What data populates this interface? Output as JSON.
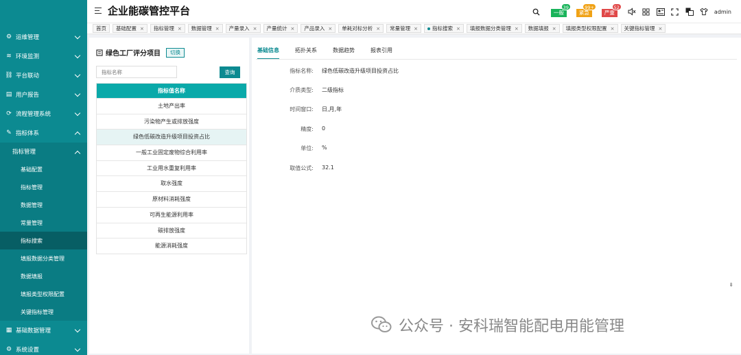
{
  "header": {
    "title": "企业能碳管控平台",
    "badges": [
      {
        "label": "一般",
        "count": "39",
        "color": "#19b35a"
      },
      {
        "label": "紧急",
        "count": "99+",
        "color": "#f0a216"
      },
      {
        "label": "严重",
        "count": "52",
        "color": "#e04848"
      }
    ],
    "user": "admin"
  },
  "tabs": [
    {
      "label": "首页",
      "closable": false
    },
    {
      "label": "基础配置",
      "closable": true
    },
    {
      "label": "指标管理",
      "closable": true
    },
    {
      "label": "数据管理",
      "closable": true
    },
    {
      "label": "产量录入",
      "closable": true
    },
    {
      "label": "产量统计",
      "closable": true
    },
    {
      "label": "产品录入",
      "closable": true
    },
    {
      "label": "单耗对标分析",
      "closable": true
    },
    {
      "label": "常量管理",
      "closable": true
    },
    {
      "label": "指标搜索",
      "closable": true,
      "active": true
    },
    {
      "label": "填报数据分类管理",
      "closable": true
    },
    {
      "label": "数据填报",
      "closable": true
    },
    {
      "label": "填报类型权限配置",
      "closable": true
    },
    {
      "label": "关键指标管理",
      "closable": true
    }
  ],
  "tab_close_glyph": "×",
  "sidebar": {
    "top_items": [
      {
        "label": "运维管理",
        "icon": "gear-icon"
      },
      {
        "label": "环境监测",
        "icon": "wave-icon"
      },
      {
        "label": "平台联动",
        "icon": "link-icon"
      },
      {
        "label": "用户报告",
        "icon": "report-icon"
      },
      {
        "label": "流程管理系统",
        "icon": "flow-icon"
      },
      {
        "label": "指标体系",
        "icon": "edit-icon"
      }
    ],
    "sub_group": "指标管理",
    "sub_items": [
      "基础配置",
      "指标管理",
      "数据管理",
      "常量管理",
      "指标搜索",
      "填报数据分类管理",
      "数据填报",
      "填报类型权限配置",
      "关键指标管理"
    ],
    "active_sub": "指标搜索",
    "bottom_items": [
      {
        "label": "基础数据管理",
        "icon": "database-icon"
      },
      {
        "label": "系统设置",
        "icon": "settings-icon"
      }
    ]
  },
  "left_panel": {
    "title": "绿色工厂评分项目",
    "switch_label": "切换",
    "search_placeholder": "指标名称",
    "search_button": "查询",
    "table_header": "指标值名称",
    "rows": [
      "土地产出率",
      "污染物产生或排放强度",
      "绿色低碳改造升级项目投资占比",
      "一般工业固定废物综合利用率",
      "工业用水重复利用率",
      "取水强度",
      "原材料消耗强度",
      "可再生能源利用率",
      "碳排放强度",
      "能源消耗强度"
    ],
    "selected_row": 2
  },
  "right_panel": {
    "tabs": [
      "基础信息",
      "拓扑关系",
      "数据趋势",
      "报表引用"
    ],
    "active_tab": 0,
    "fields": [
      {
        "label": "指标名称:",
        "value": "绿色低碳改造升级项目投资占比"
      },
      {
        "label": "介质类型:",
        "value": "二级指标"
      },
      {
        "label": "时间窗口:",
        "value": "日,月,年"
      },
      {
        "label": "精度:",
        "value": "0"
      },
      {
        "label": "单位:",
        "value": "%"
      },
      {
        "label": "取值公式:",
        "value": "32.1"
      }
    ]
  },
  "watermark": "公众号 · 安科瑞智能配电用能管理"
}
